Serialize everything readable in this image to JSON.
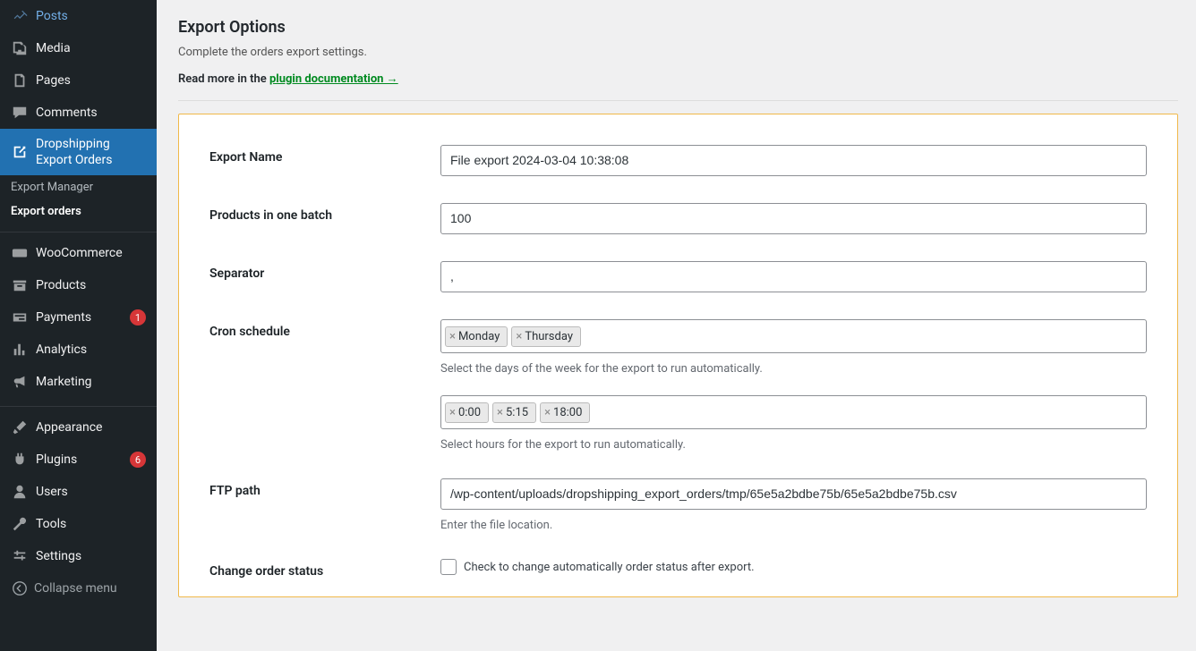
{
  "sidebar": {
    "items": [
      {
        "label": "Posts",
        "icon": "pin"
      },
      {
        "label": "Media",
        "icon": "media"
      },
      {
        "label": "Pages",
        "icon": "page"
      },
      {
        "label": "Comments",
        "icon": "comment"
      },
      {
        "label": "Dropshipping Export Orders",
        "icon": "share",
        "current": true,
        "sub": [
          {
            "label": "Export Manager"
          },
          {
            "label": "Export orders",
            "active": true
          }
        ]
      },
      {
        "sep": true
      },
      {
        "label": "WooCommerce",
        "icon": "woo"
      },
      {
        "label": "Products",
        "icon": "archive"
      },
      {
        "label": "Payments",
        "icon": "payments",
        "badge": "1"
      },
      {
        "label": "Analytics",
        "icon": "analytics"
      },
      {
        "label": "Marketing",
        "icon": "megaphone"
      },
      {
        "sep": true
      },
      {
        "label": "Appearance",
        "icon": "brush"
      },
      {
        "label": "Plugins",
        "icon": "plug",
        "badge": "6"
      },
      {
        "label": "Users",
        "icon": "user"
      },
      {
        "label": "Tools",
        "icon": "wrench"
      },
      {
        "label": "Settings",
        "icon": "sliders"
      }
    ],
    "collapse": "Collapse menu"
  },
  "page": {
    "title": "Export Options",
    "desc": "Complete the orders export settings.",
    "doc_prefix": "Read more in the ",
    "doc_link": "plugin documentation →"
  },
  "form": {
    "export_name": {
      "label": "Export Name",
      "value": "File export 2024-03-04 10:38:08"
    },
    "batch": {
      "label": "Products in one batch",
      "value": "100"
    },
    "separator": {
      "label": "Separator",
      "value": ","
    },
    "cron": {
      "label": "Cron schedule",
      "days": [
        "Monday",
        "Thursday"
      ],
      "days_help": "Select the days of the week for the export to run automatically.",
      "hours": [
        "0:00",
        "5:15",
        "18:00"
      ],
      "hours_help": "Select hours for the export to run automatically."
    },
    "ftp": {
      "label": "FTP path",
      "value": "/wp-content/uploads/dropshipping_export_orders/tmp/65e5a2bdbe75b/65e5a2bdbe75b.csv",
      "help": "Enter the file location."
    },
    "status": {
      "label": "Change order status",
      "check_label": "Check to change automatically order status after export."
    }
  }
}
